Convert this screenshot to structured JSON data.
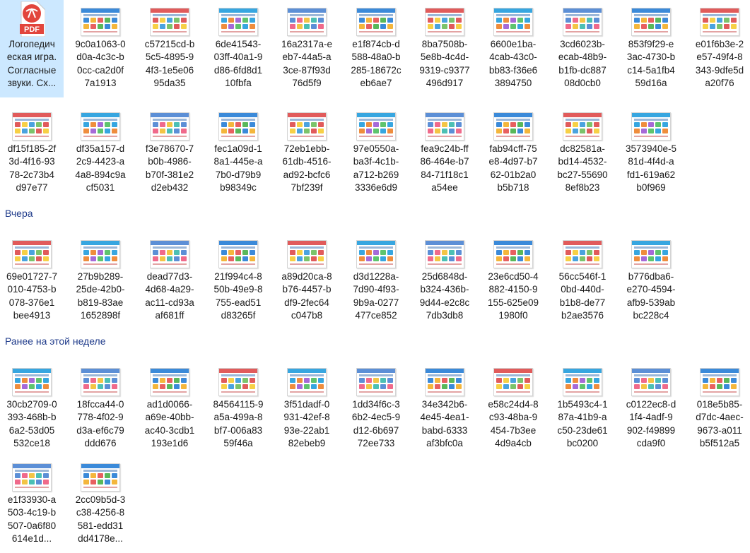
{
  "pdf_item": {
    "badge": "PDF",
    "name": "Логопедическая игра. Согласные звуки. Сх...",
    "name_lines": [
      "Логопедич",
      "еская игра.",
      "Согласные",
      "звуки. Сх..."
    ]
  },
  "groups": [
    {
      "header": "",
      "rows": [
        [
          {
            "lines": [
              "9c0a1063-0",
              "d0a-4c3c-b",
              "0cc-ca2d0f",
              "7a1913"
            ]
          },
          {
            "lines": [
              "c57215cd-b",
              "5c5-4895-9",
              "4f3-1e5e06",
              "95da35"
            ]
          },
          {
            "lines": [
              "6de41543-",
              "03ff-40a1-9",
              "d86-6fd8d1",
              "10fbfa"
            ]
          },
          {
            "lines": [
              "16a2317a-e",
              "eb7-44a5-a",
              "3ce-87f93d",
              "76d5f9"
            ]
          },
          {
            "lines": [
              "e1f874cb-d",
              "588-48a0-b",
              "285-18672c",
              "eb6ae7"
            ]
          },
          {
            "lines": [
              "8ba7508b-",
              "5e8b-4c4d-",
              "9319-c9377",
              "496d917"
            ]
          },
          {
            "lines": [
              "6600e1ba-",
              "4cab-43c0-",
              "bb83-f36e6",
              "3894750"
            ]
          },
          {
            "lines": [
              "3cd6023b-",
              "ecab-48b9-",
              "b1fb-dc887",
              "08d0cb0"
            ]
          },
          {
            "lines": [
              "853f9f29-e",
              "3ac-4730-b",
              "c14-5a1fb4",
              "59d16a"
            ]
          },
          {
            "lines": [
              "e01f6b3e-2",
              "e57-49f4-8",
              "343-9dfe5d",
              "a20f76"
            ]
          }
        ],
        [
          {
            "lines": [
              "df15f185-2f",
              "3d-4f16-93",
              "78-2c73b4",
              "d97e77"
            ]
          },
          {
            "lines": [
              "df35a157-d",
              "2c9-4423-a",
              "4a8-894c9a",
              "cf5031"
            ]
          },
          {
            "lines": [
              "f3e78670-7",
              "b0b-4986-",
              "b70f-381e2",
              "d2eb432"
            ]
          },
          {
            "lines": [
              "fec1a09d-1",
              "8a1-445e-a",
              "7b0-d79b9",
              "b98349c"
            ]
          },
          {
            "lines": [
              "72eb1ebb-",
              "61db-4516-",
              "ad92-bcfc6",
              "7bf239f"
            ]
          },
          {
            "lines": [
              "97e0550a-",
              "ba3f-4c1b-",
              "a712-b269",
              "3336e6d9"
            ]
          },
          {
            "lines": [
              "fea9c24b-ff",
              "86-464e-b7",
              "84-71f18c1",
              "a54ee"
            ]
          },
          {
            "lines": [
              "fab94cff-75",
              "e8-4d97-b7",
              "62-01b2a0",
              "b5b718"
            ]
          },
          {
            "lines": [
              "dc82581a-",
              "bd14-4532-",
              "bc27-55690",
              "8ef8b23"
            ]
          },
          {
            "lines": [
              "3573940e-5",
              "81d-4f4d-a",
              "fd1-619a62",
              "b0f969"
            ]
          }
        ]
      ]
    },
    {
      "header": "Вчера",
      "rows": [
        [
          {
            "lines": [
              "69e01727-7",
              "010-4753-b",
              "078-376e1",
              "bee4913"
            ]
          },
          {
            "lines": [
              "27b9b289-",
              "25de-42b0-",
              "b819-83ae",
              "1652898f"
            ]
          },
          {
            "lines": [
              "dead77d3-",
              "4d68-4a29-",
              "ac11-cd93a",
              "af681ff"
            ]
          },
          {
            "lines": [
              "21f994c4-8",
              "50b-49e9-8",
              "755-ead51",
              "d83265f"
            ]
          },
          {
            "lines": [
              "a89d20ca-8",
              "b76-4457-b",
              "df9-2fec64",
              "c047b8"
            ]
          },
          {
            "lines": [
              "d3d1228a-",
              "7d90-4f93-",
              "9b9a-0277",
              "477ce852"
            ]
          },
          {
            "lines": [
              "25d6848d-",
              "b324-436b-",
              "9d44-e2c8c",
              "7db3db8"
            ]
          },
          {
            "lines": [
              "23e6cd50-4",
              "882-4150-9",
              "155-625e09",
              "1980f0"
            ]
          },
          {
            "lines": [
              "56cc546f-1",
              "0bd-440d-",
              "b1b8-de77",
              "b2ae3576"
            ]
          },
          {
            "lines": [
              "b776dba6-",
              "e270-4594-",
              "afb9-539ab",
              "bc228c4"
            ]
          }
        ]
      ]
    },
    {
      "header": "Ранее на этой неделе",
      "rows": [
        [
          {
            "lines": [
              "30cb2709-0",
              "393-468b-b",
              "6a2-53d05",
              "532ce18"
            ]
          },
          {
            "lines": [
              "18fcca44-0",
              "778-4f02-9",
              "d3a-ef6c79",
              "ddd676"
            ]
          },
          {
            "lines": [
              "ad1d0066-",
              "a69e-40bb-",
              "ac40-3cdb1",
              "193e1d6"
            ]
          },
          {
            "lines": [
              "84564115-9",
              "a5a-499a-8",
              "bf7-006a83",
              "59f46a"
            ]
          },
          {
            "lines": [
              "3f51dadf-0",
              "931-42ef-8",
              "93e-22ab1",
              "82ebeb9"
            ]
          },
          {
            "lines": [
              "1dd34f6c-3",
              "6b2-4ec5-9",
              "d12-6b697",
              "72ee733"
            ]
          },
          {
            "lines": [
              "34e342b6-",
              "4e45-4ea1-",
              "babd-6333",
              "af3bfc0a"
            ]
          },
          {
            "lines": [
              "e58c24d4-8",
              "c93-48ba-9",
              "454-7b3ee",
              "4d9a4cb"
            ]
          },
          {
            "lines": [
              "1b5493c4-1",
              "87a-41b9-a",
              "c50-23de61",
              "bc0200"
            ]
          },
          {
            "lines": [
              "c0122ec8-d",
              "1f4-4adf-9",
              "902-f49899",
              "cda9f0"
            ]
          },
          {
            "lines": [
              "018e5b85-",
              "d7dc-4aec-",
              "9673-a011",
              "b5f512a5"
            ]
          }
        ],
        [
          {
            "lines": [
              "e1f33930-a",
              "503-4c19-b",
              "507-0a6f80",
              "614e1d..."
            ]
          },
          {
            "lines": [
              "2cc09b5d-3",
              "c38-4256-8",
              "581-edd31",
              "dd4178e..."
            ]
          }
        ]
      ]
    }
  ],
  "colors": {
    "selected_bg": "#cce8ff",
    "group_header": "#1e3a8a",
    "pdf_red": "#e2453c"
  }
}
